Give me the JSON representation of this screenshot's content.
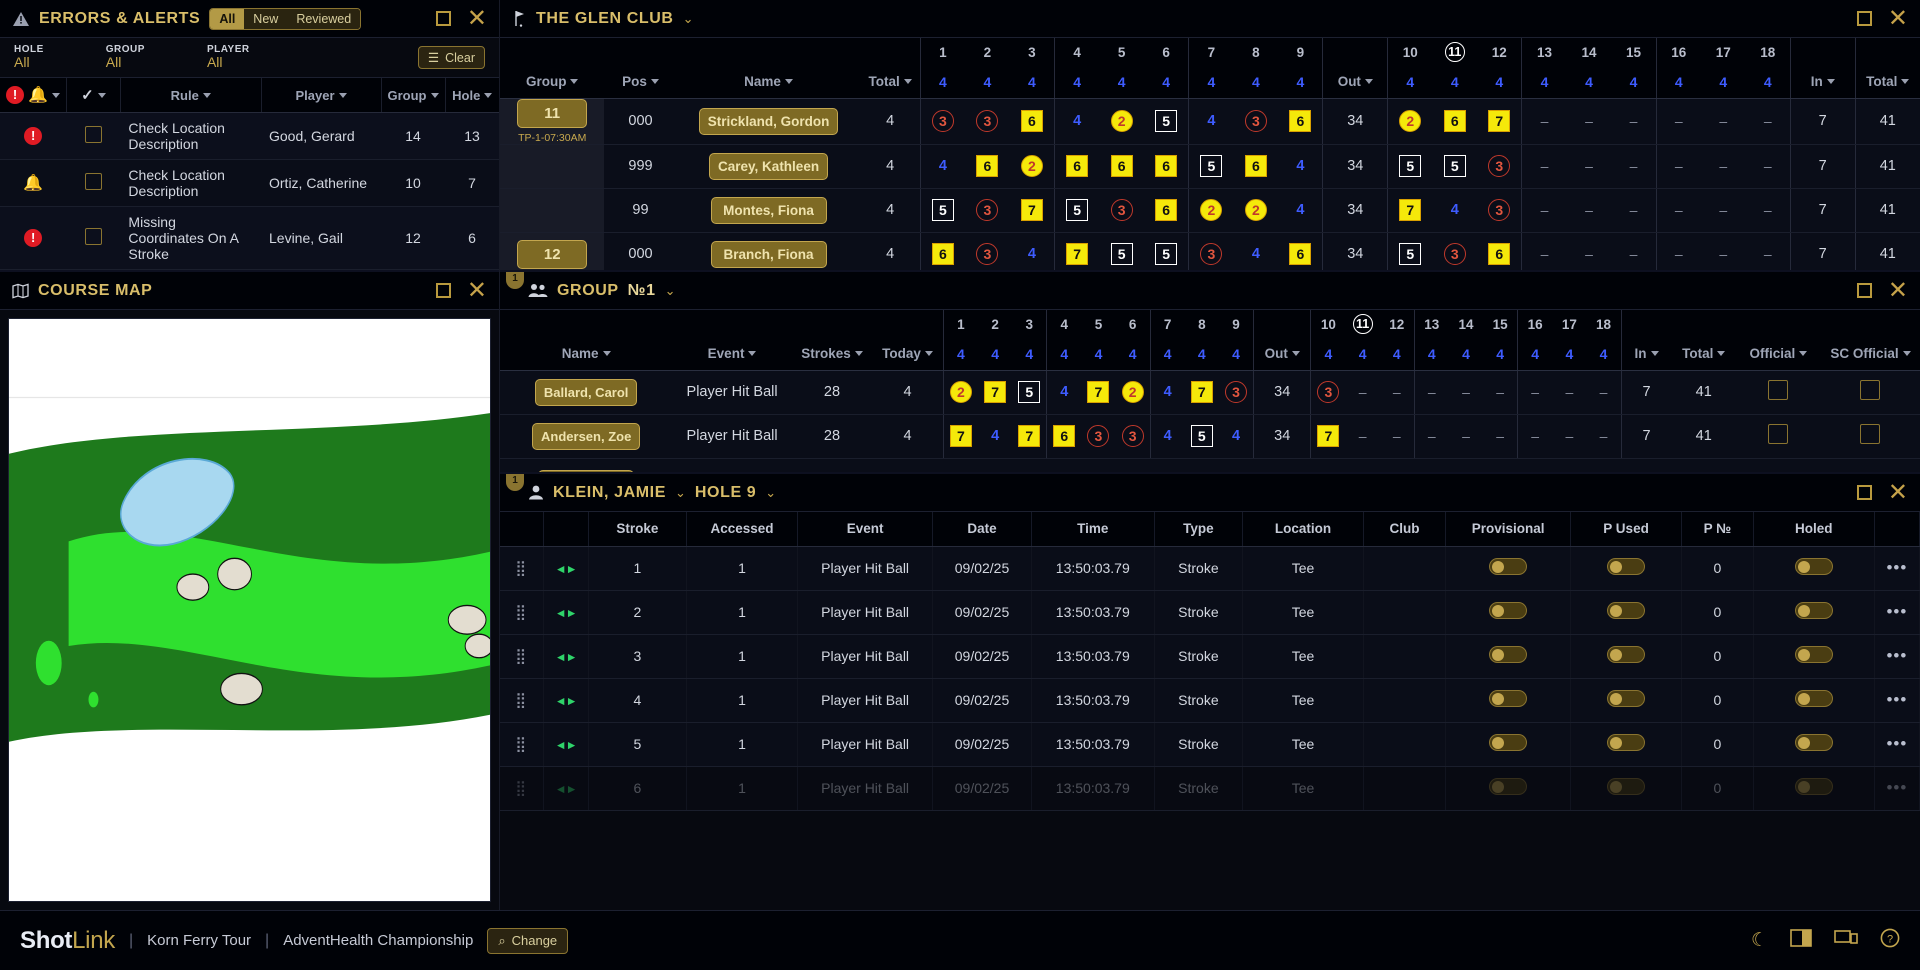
{
  "alerts_panel": {
    "title": "ERRORS & ALERTS",
    "icon": "warning-triangle-icon",
    "segments": [
      {
        "label": "All",
        "active": true
      },
      {
        "label": "New",
        "active": false
      },
      {
        "label": "Reviewed",
        "active": false
      }
    ],
    "filters": [
      {
        "key": "HOLE",
        "value": "All"
      },
      {
        "key": "GROUP",
        "value": "All"
      },
      {
        "key": "PLAYER",
        "value": "All"
      }
    ],
    "clear_label": "Clear",
    "columns": [
      "Rule",
      "Player",
      "Group",
      "Hole"
    ],
    "rows": [
      {
        "severity": "error",
        "checked": false,
        "rule": "Check Location Description",
        "player": "Good, Gerard",
        "group": "14",
        "hole": "13"
      },
      {
        "severity": "alert",
        "checked": false,
        "rule": "Check Location Description",
        "player": "Ortiz, Catherine",
        "group": "10",
        "hole": "7"
      },
      {
        "severity": "error",
        "checked": false,
        "rule": "Missing Coordinates On A Stroke",
        "player": "Levine, Gail",
        "group": "12",
        "hole": "6"
      }
    ]
  },
  "course_map": {
    "title": "COURSE MAP",
    "icon": "map-icon"
  },
  "scorecard": {
    "title": "THE GLEN CLUB",
    "icon": "golf-flag-icon",
    "columns": [
      "Group",
      "Pos",
      "Name",
      "Total"
    ],
    "holes": [
      "1",
      "2",
      "3",
      "4",
      "5",
      "6",
      "7",
      "8",
      "9",
      "Out",
      "10",
      "11",
      "12",
      "13",
      "14",
      "15",
      "16",
      "17",
      "18",
      "In",
      "Total"
    ],
    "current_hole": "11",
    "pars": [
      "4",
      "4",
      "4",
      "4",
      "4",
      "4",
      "4",
      "4",
      "4",
      "",
      "4",
      "4",
      "4",
      "4",
      "4",
      "4",
      "4",
      "4",
      "4",
      "",
      ""
    ],
    "rows": [
      {
        "group": "11",
        "group_time": "TP-1-07:30AM",
        "pos": "000",
        "name": "Strickland, Gordon",
        "total": "4",
        "scores": [
          {
            "v": "3",
            "s": "ci-r"
          },
          {
            "v": "3",
            "s": "ci-r"
          },
          {
            "v": "6",
            "s": "sq-y"
          },
          {
            "v": "4",
            "s": "pl-b"
          },
          {
            "v": "2",
            "s": "ci-y"
          },
          {
            "v": "5",
            "s": "sq-w"
          },
          {
            "v": "4",
            "s": "pl-b"
          },
          {
            "v": "3",
            "s": "ci-r"
          },
          {
            "v": "6",
            "s": "sq-y"
          },
          {
            "v": "34",
            "s": "pl-n"
          },
          {
            "v": "2",
            "s": "ci-y"
          },
          {
            "v": "6",
            "s": "sq-y"
          },
          {
            "v": "7",
            "s": "sq-y"
          },
          {
            "v": "–",
            "s": "dash"
          },
          {
            "v": "–",
            "s": "dash"
          },
          {
            "v": "–",
            "s": "dash"
          },
          {
            "v": "–",
            "s": "dash"
          },
          {
            "v": "–",
            "s": "dash"
          },
          {
            "v": "–",
            "s": "dash"
          },
          {
            "v": "7",
            "s": "pl-n"
          },
          {
            "v": "41",
            "s": "pl-n"
          }
        ]
      },
      {
        "group": "",
        "group_time": "",
        "pos": "999",
        "name": "Carey, Kathleen",
        "total": "4",
        "scores": [
          {
            "v": "4",
            "s": "pl-b"
          },
          {
            "v": "6",
            "s": "sq-y"
          },
          {
            "v": "2",
            "s": "ci-y"
          },
          {
            "v": "6",
            "s": "sq-y"
          },
          {
            "v": "6",
            "s": "sq-y"
          },
          {
            "v": "6",
            "s": "sq-y"
          },
          {
            "v": "5",
            "s": "sq-w"
          },
          {
            "v": "6",
            "s": "sq-y"
          },
          {
            "v": "4",
            "s": "pl-b"
          },
          {
            "v": "34",
            "s": "pl-n"
          },
          {
            "v": "5",
            "s": "sq-w"
          },
          {
            "v": "5",
            "s": "sq-w"
          },
          {
            "v": "3",
            "s": "ci-r"
          },
          {
            "v": "–",
            "s": "dash"
          },
          {
            "v": "–",
            "s": "dash"
          },
          {
            "v": "–",
            "s": "dash"
          },
          {
            "v": "–",
            "s": "dash"
          },
          {
            "v": "–",
            "s": "dash"
          },
          {
            "v": "–",
            "s": "dash"
          },
          {
            "v": "7",
            "s": "pl-n"
          },
          {
            "v": "41",
            "s": "pl-n"
          }
        ]
      },
      {
        "group": "",
        "group_time": "",
        "pos": "99",
        "name": "Montes, Fiona",
        "total": "4",
        "scores": [
          {
            "v": "5",
            "s": "sq-w"
          },
          {
            "v": "3",
            "s": "ci-r"
          },
          {
            "v": "7",
            "s": "sq-y"
          },
          {
            "v": "5",
            "s": "sq-w"
          },
          {
            "v": "3",
            "s": "ci-r"
          },
          {
            "v": "6",
            "s": "sq-y"
          },
          {
            "v": "2",
            "s": "ci-y"
          },
          {
            "v": "2",
            "s": "ci-y"
          },
          {
            "v": "4",
            "s": "pl-b"
          },
          {
            "v": "34",
            "s": "pl-n"
          },
          {
            "v": "7",
            "s": "sq-y"
          },
          {
            "v": "4",
            "s": "pl-b"
          },
          {
            "v": "3",
            "s": "ci-r"
          },
          {
            "v": "–",
            "s": "dash"
          },
          {
            "v": "–",
            "s": "dash"
          },
          {
            "v": "–",
            "s": "dash"
          },
          {
            "v": "–",
            "s": "dash"
          },
          {
            "v": "–",
            "s": "dash"
          },
          {
            "v": "–",
            "s": "dash"
          },
          {
            "v": "7",
            "s": "pl-n"
          },
          {
            "v": "41",
            "s": "pl-n"
          }
        ]
      },
      {
        "group": "12",
        "group_time": "",
        "pos": "000",
        "name": "Branch, Fiona",
        "total": "4",
        "scores": [
          {
            "v": "6",
            "s": "sq-y"
          },
          {
            "v": "3",
            "s": "ci-r"
          },
          {
            "v": "4",
            "s": "pl-b"
          },
          {
            "v": "7",
            "s": "sq-y"
          },
          {
            "v": "5",
            "s": "sq-w"
          },
          {
            "v": "5",
            "s": "sq-w"
          },
          {
            "v": "3",
            "s": "ci-r"
          },
          {
            "v": "4",
            "s": "pl-b"
          },
          {
            "v": "6",
            "s": "sq-y"
          },
          {
            "v": "34",
            "s": "pl-n"
          },
          {
            "v": "5",
            "s": "sq-w"
          },
          {
            "v": "3",
            "s": "ci-r"
          },
          {
            "v": "6",
            "s": "sq-y"
          },
          {
            "v": "–",
            "s": "dash"
          },
          {
            "v": "–",
            "s": "dash"
          },
          {
            "v": "–",
            "s": "dash"
          },
          {
            "v": "–",
            "s": "dash"
          },
          {
            "v": "–",
            "s": "dash"
          },
          {
            "v": "–",
            "s": "dash"
          },
          {
            "v": "7",
            "s": "pl-n"
          },
          {
            "v": "41",
            "s": "pl-n"
          }
        ]
      }
    ]
  },
  "group_panel": {
    "title": "GROUP",
    "number": "№1",
    "icon": "people-icon",
    "badge": "1",
    "columns": [
      "Name",
      "Event",
      "Strokes",
      "Today"
    ],
    "tail_columns": [
      "In",
      "Total",
      "Official",
      "SC Official"
    ],
    "holes": [
      "1",
      "2",
      "3",
      "4",
      "5",
      "6",
      "7",
      "8",
      "9",
      "Out",
      "10",
      "11",
      "12",
      "13",
      "14",
      "15",
      "16",
      "17",
      "18"
    ],
    "current_hole": "11",
    "pars": [
      "4",
      "4",
      "4",
      "4",
      "4",
      "4",
      "4",
      "4",
      "4",
      "",
      "4",
      "4",
      "4",
      "4",
      "4",
      "4",
      "4",
      "4",
      "4"
    ],
    "rows": [
      {
        "name": "Ballard, Carol",
        "event": "Player Hit Ball",
        "strokes": "28",
        "today": "4",
        "in": "7",
        "total": "41",
        "official": false,
        "sc_official": false,
        "scores": [
          {
            "v": "2",
            "s": "ci-y"
          },
          {
            "v": "7",
            "s": "sq-y"
          },
          {
            "v": "5",
            "s": "sq-w"
          },
          {
            "v": "4",
            "s": "pl-b"
          },
          {
            "v": "7",
            "s": "sq-y"
          },
          {
            "v": "2",
            "s": "ci-y"
          },
          {
            "v": "4",
            "s": "pl-b"
          },
          {
            "v": "7",
            "s": "sq-y"
          },
          {
            "v": "3",
            "s": "ci-r"
          },
          {
            "v": "34",
            "s": "pl-n"
          },
          {
            "v": "3",
            "s": "ci-r"
          },
          {
            "v": "–",
            "s": "dash"
          },
          {
            "v": "–",
            "s": "dash"
          },
          {
            "v": "–",
            "s": "dash"
          },
          {
            "v": "–",
            "s": "dash"
          },
          {
            "v": "–",
            "s": "dash"
          },
          {
            "v": "–",
            "s": "dash"
          },
          {
            "v": "–",
            "s": "dash"
          },
          {
            "v": "–",
            "s": "dash"
          }
        ]
      },
      {
        "name": "Andersen, Zoe",
        "event": "Player Hit Ball",
        "strokes": "28",
        "today": "4",
        "in": "7",
        "total": "41",
        "official": false,
        "sc_official": false,
        "scores": [
          {
            "v": "7",
            "s": "sq-y"
          },
          {
            "v": "4",
            "s": "pl-b"
          },
          {
            "v": "7",
            "s": "sq-y"
          },
          {
            "v": "6",
            "s": "sq-y"
          },
          {
            "v": "3",
            "s": "ci-r"
          },
          {
            "v": "3",
            "s": "ci-r"
          },
          {
            "v": "4",
            "s": "pl-b"
          },
          {
            "v": "5",
            "s": "sq-w"
          },
          {
            "v": "4",
            "s": "pl-b"
          },
          {
            "v": "34",
            "s": "pl-n"
          },
          {
            "v": "7",
            "s": "sq-y"
          },
          {
            "v": "–",
            "s": "dash"
          },
          {
            "v": "–",
            "s": "dash"
          },
          {
            "v": "–",
            "s": "dash"
          },
          {
            "v": "–",
            "s": "dash"
          },
          {
            "v": "–",
            "s": "dash"
          },
          {
            "v": "–",
            "s": "dash"
          },
          {
            "v": "–",
            "s": "dash"
          },
          {
            "v": "–",
            "s": "dash"
          }
        ]
      }
    ]
  },
  "detail_panel": {
    "player": "KLEIN, JAMIE",
    "hole": "HOLE 9",
    "icon": "person-icon",
    "badge": "1",
    "columns": [
      "",
      "",
      "Stroke",
      "Accessed",
      "Event",
      "Date",
      "Time",
      "Type",
      "Location",
      "Club",
      "Provisional",
      "P Used",
      "P №",
      "Holed",
      ""
    ],
    "rows": [
      {
        "stroke": "1",
        "accessed": "1",
        "event": "Player Hit Ball",
        "date": "09/02/25",
        "time": "13:50:03.79",
        "type": "Stroke",
        "location": "Tee",
        "club": "",
        "provisional": false,
        "p_used": false,
        "p_no": "0",
        "holed": false
      },
      {
        "stroke": "2",
        "accessed": "1",
        "event": "Player Hit Ball",
        "date": "09/02/25",
        "time": "13:50:03.79",
        "type": "Stroke",
        "location": "Tee",
        "club": "",
        "provisional": false,
        "p_used": false,
        "p_no": "0",
        "holed": false
      },
      {
        "stroke": "3",
        "accessed": "1",
        "event": "Player Hit Ball",
        "date": "09/02/25",
        "time": "13:50:03.79",
        "type": "Stroke",
        "location": "Tee",
        "club": "",
        "provisional": false,
        "p_used": false,
        "p_no": "0",
        "holed": false
      },
      {
        "stroke": "4",
        "accessed": "1",
        "event": "Player Hit Ball",
        "date": "09/02/25",
        "time": "13:50:03.79",
        "type": "Stroke",
        "location": "Tee",
        "club": "",
        "provisional": false,
        "p_used": false,
        "p_no": "0",
        "holed": false
      },
      {
        "stroke": "5",
        "accessed": "1",
        "event": "Player Hit Ball",
        "date": "09/02/25",
        "time": "13:50:03.79",
        "type": "Stroke",
        "location": "Tee",
        "club": "",
        "provisional": false,
        "p_used": false,
        "p_no": "0",
        "holed": false
      },
      {
        "stroke": "6",
        "accessed": "1",
        "event": "Player Hit Ball",
        "date": "09/02/25",
        "time": "13:50:03.79",
        "type": "Stroke",
        "location": "Tee",
        "club": "",
        "provisional": false,
        "p_used": false,
        "p_no": "0",
        "holed": false
      }
    ]
  },
  "footer": {
    "brand_bold": "Shot",
    "brand_light": "Link",
    "tour": "Korn Ferry Tour",
    "event": "AdventHealth Championship",
    "change_label": "Change",
    "icons": [
      "moon-icon",
      "layout-icon",
      "monitor-icon",
      "help-icon"
    ]
  },
  "colors": {
    "accent": "#c3a64e",
    "background": "#0b0d17",
    "par": "#3e5cff",
    "error": "#e01b24",
    "alert": "#f2c21a"
  }
}
